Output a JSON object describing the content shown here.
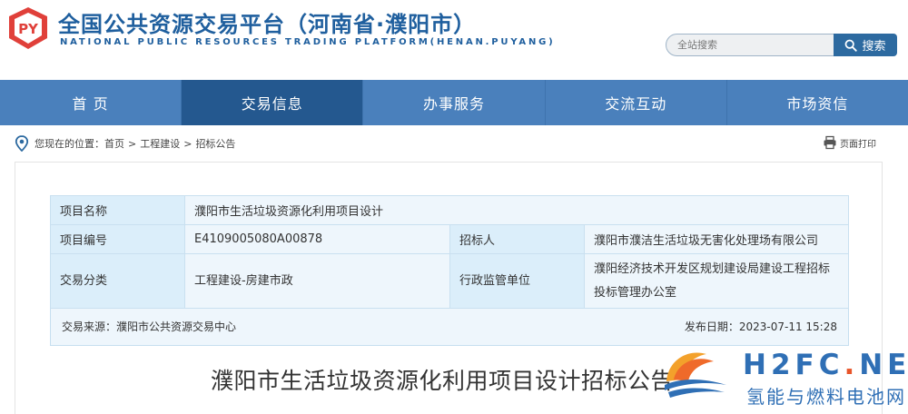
{
  "header": {
    "logo_text": "PY",
    "title_cn": "全国公共资源交易平台（河南省·濮阳市）",
    "title_en": "NATIONAL PUBLIC RESOURCES TRADING PLATFORM(HENAN.PUYANG)",
    "search_placeholder": "全站搜索",
    "search_button": "搜索"
  },
  "nav": {
    "items": [
      {
        "label": "首 页"
      },
      {
        "label": "交易信息"
      },
      {
        "label": "办事服务"
      },
      {
        "label": "交流互动"
      },
      {
        "label": "市场资信"
      }
    ],
    "active_index": 1
  },
  "breadcrumb": {
    "prefix": "您现在的位置：",
    "items": [
      "首页",
      "工程建设",
      "招标公告"
    ],
    "separator": ">",
    "print_label": "页面打印"
  },
  "info": {
    "project_name_label": "项目名称",
    "project_name": "濮阳市生活垃圾资源化利用项目设计",
    "project_no_label": "项目编号",
    "project_no": "E4109005080A00878",
    "tenderer_label": "招标人",
    "tenderer": "濮阳市濮洁生活垃圾无害化处理场有限公司",
    "category_label": "交易分类",
    "category": "工程建设-房建市政",
    "supervisor_label": "行政监管单位",
    "supervisor": "濮阳经济技术开发区规划建设局建设工程招标投标管理办公室",
    "source": "交易来源：濮阳市公共资源交易中心",
    "publish": "发布日期：2023-07-11 15:28"
  },
  "article": {
    "title": "濮阳市生活垃圾资源化利用项目设计招标公告"
  },
  "watermark": {
    "brand_a": "H2FC",
    "brand_dot": ".",
    "brand_b": "NET",
    "subtitle": "氢能与燃料电池网"
  },
  "colors": {
    "brand_blue": "#1f5f9e",
    "nav_bg": "#4a80bc",
    "nav_active": "#24588f",
    "logo_red": "#e0403a"
  }
}
